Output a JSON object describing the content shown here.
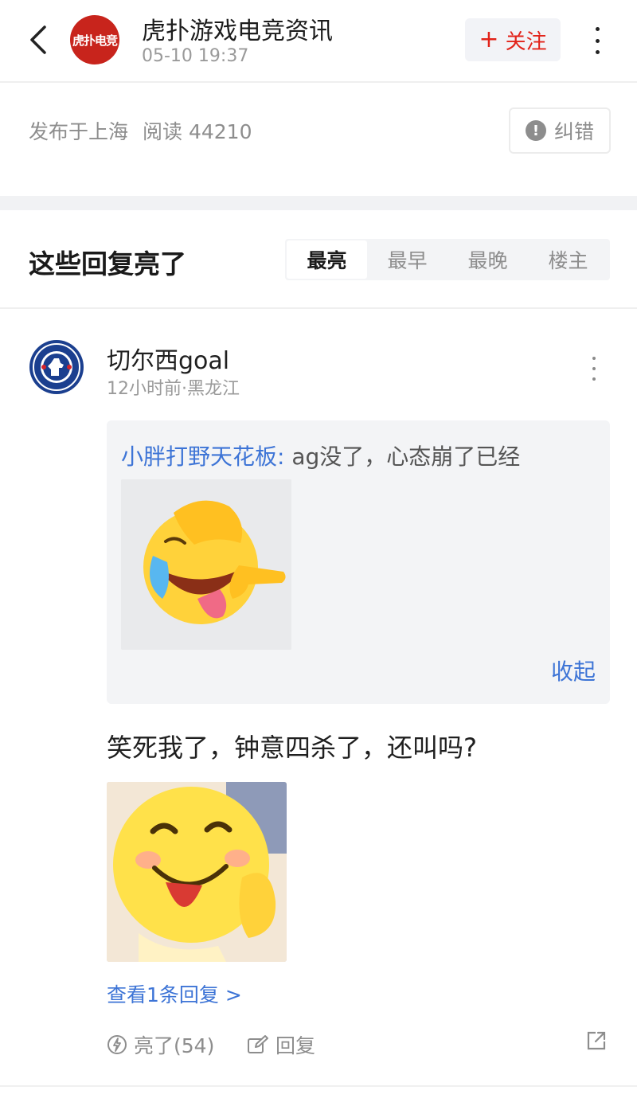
{
  "header": {
    "brand_avatar_text": "虎扑电竞",
    "publisher_name": "虎扑游戏电竞资讯",
    "publish_time": "05-10 19:37",
    "follow_label": "关注"
  },
  "meta": {
    "location": "发布于上海",
    "reads": "阅读 44210",
    "correct_label": "纠错"
  },
  "highlights": {
    "title": "这些回复亮了",
    "tabs": [
      {
        "label": "最亮",
        "active": true
      },
      {
        "label": "最早",
        "active": false
      },
      {
        "label": "最晚",
        "active": false
      },
      {
        "label": "楼主",
        "active": false
      }
    ]
  },
  "comment": {
    "user_name": "切尔西goal",
    "meta": "12小时前·黑龙江",
    "quote": {
      "author": "小胖打野天花板:",
      "text": " ag没了，心态崩了已经",
      "collapse_label": "收起"
    },
    "text": "笑死我了，钟意四杀了，还叫吗?",
    "view_replies": "查看1条回复 >",
    "actions": {
      "light_label": "亮了(54)",
      "reply_label": "回复"
    }
  },
  "colors": {
    "accent_blue": "#3d74d6",
    "follow_red": "#e2231a",
    "brand_red": "#c8241c",
    "muted_gray": "#8d8d8d"
  },
  "icons": [
    "back-arrow-icon",
    "more-vertical-icon",
    "plus-icon",
    "alert-icon",
    "lightning-icon",
    "edit-icon",
    "share-icon",
    "chelsea-crest",
    "laughing-emoji",
    "tongue-out-emoji"
  ]
}
